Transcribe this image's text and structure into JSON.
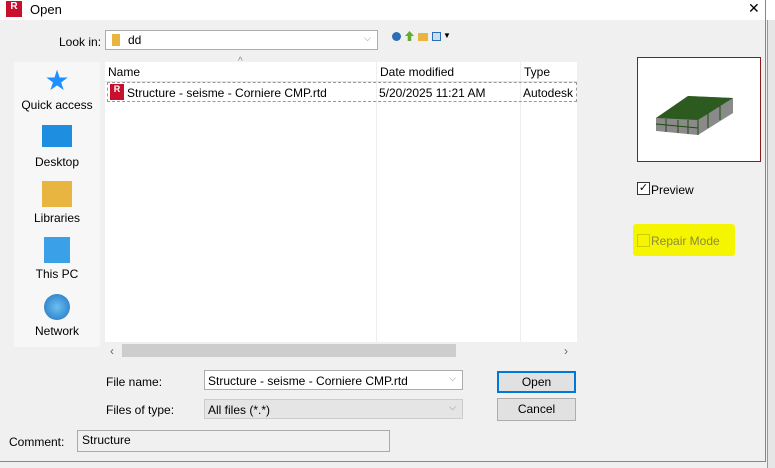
{
  "window": {
    "title": "Open",
    "close_icon": "✕"
  },
  "toolbar": {
    "look_in_label": "Look in:",
    "look_in_value": "dd"
  },
  "places": [
    {
      "label": "Quick access"
    },
    {
      "label": "Desktop"
    },
    {
      "label": "Libraries"
    },
    {
      "label": "This PC"
    },
    {
      "label": "Network"
    }
  ],
  "list": {
    "columns": [
      "Name",
      "Date modified",
      "Type"
    ],
    "rows": [
      {
        "name": "Structure - seisme - Corniere CMP.rtd",
        "date": "5/20/2025 11:21 AM",
        "type": "Autodesk"
      }
    ]
  },
  "form": {
    "file_name_label": "File name:",
    "file_name_value": "Structure - seisme - Corniere CMP.rtd",
    "file_type_label": "Files of type:",
    "file_type_value": "All files (*.*)",
    "open_label": "Open",
    "cancel_label": "Cancel",
    "comment_label": "Comment:",
    "comment_value": "Structure"
  },
  "options": {
    "preview_label": "Preview",
    "preview_checked": true,
    "repair_label": "Repair Mode",
    "repair_checked": false
  },
  "colors": {
    "highlight": "#f5f500",
    "preview_border": "#8b1a1a",
    "accent": "#0078d7"
  }
}
